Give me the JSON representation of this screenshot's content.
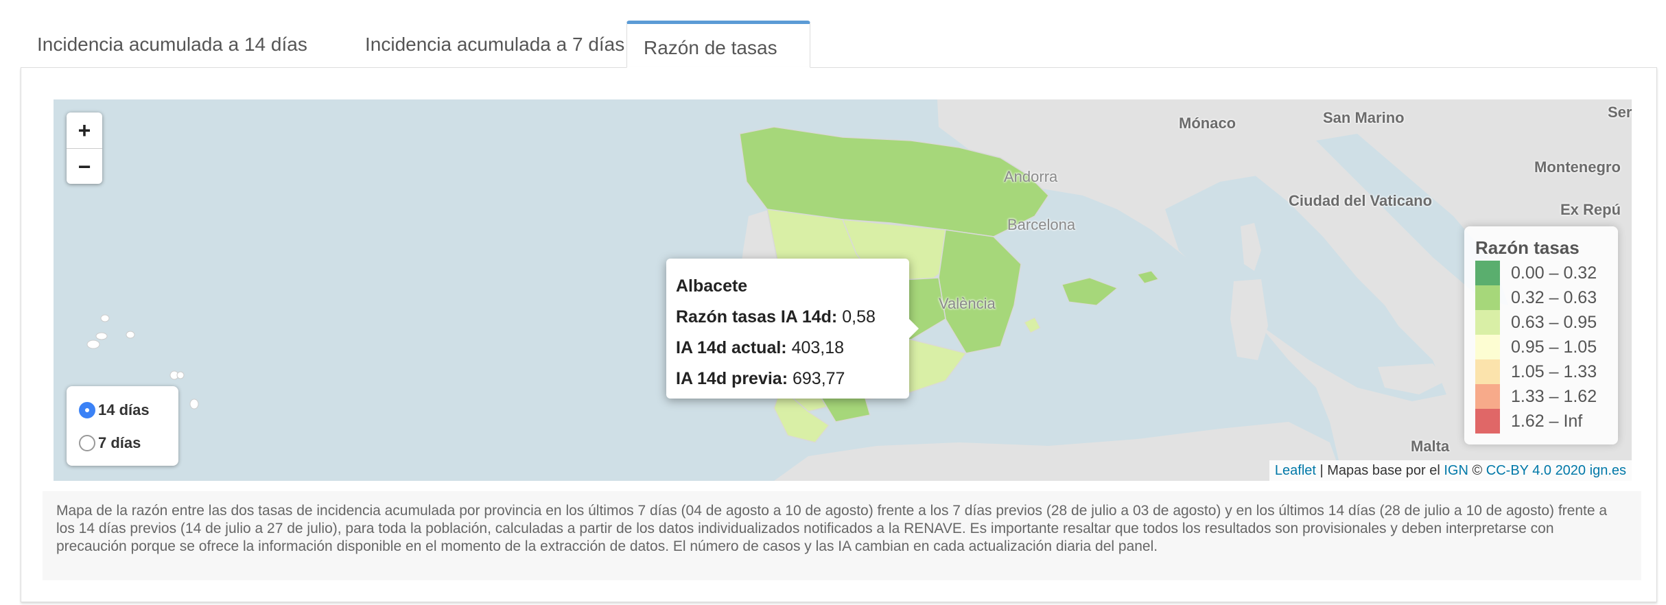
{
  "tabs": [
    {
      "label": "Incidencia acumulada a 14 días",
      "active": false
    },
    {
      "label": "Incidencia acumulada a 7 días",
      "active": false
    },
    {
      "label": "Razón de tasas",
      "active": true
    }
  ],
  "map": {
    "zoom_in": "+",
    "zoom_out": "−",
    "place_labels": [
      "Mónaco",
      "San Marino",
      "Ser",
      "Montenegro",
      "Ciudad del Vaticano",
      "Ex Repú",
      "Andorra",
      "Barcelona",
      "València",
      "Malta"
    ],
    "radio_options": [
      {
        "label": "14 días",
        "selected": true
      },
      {
        "label": "7 días",
        "selected": false
      }
    ],
    "tooltip": {
      "title": "Albacete",
      "ratio_label": "Razón tasas IA 14d:",
      "ratio_value": "0,58",
      "current_label": "IA 14d actual:",
      "current_value": "403,18",
      "previous_label": "IA 14d previa:",
      "previous_value": "693,77"
    },
    "legend": {
      "title": "Razón tasas",
      "items": [
        {
          "range": "0.00 – 0.32",
          "color": "#5aae6e"
        },
        {
          "range": "0.32 – 0.63",
          "color": "#a6d77a"
        },
        {
          "range": "0.63 – 0.95",
          "color": "#d9efa6"
        },
        {
          "range": "0.95 – 1.05",
          "color": "#fdfdd2"
        },
        {
          "range": "1.05 – 1.33",
          "color": "#fbe3ac"
        },
        {
          "range": "1.33 – 1.62",
          "color": "#f7aa8a"
        },
        {
          "range": "1.62 – Inf",
          "color": "#e06767"
        }
      ]
    },
    "attribution": {
      "leaflet": "Leaflet",
      "separator": " | Mapas base por el ",
      "ign": "IGN",
      "copyright": " © ",
      "license": "CC-BY 4.0 2020",
      "site": "ign.es"
    }
  },
  "caption": "Mapa de la razón entre las dos tasas de incidencia acumulada por provincia en los últimos 7 días (04 de agosto a 10 de agosto) frente a los 7 días previos (28 de julio a 03 de agosto) y en los últimos 14 días (28 de julio a 10 de agosto) frente a los 14 días previos (14 de julio a 27 de julio), para toda la población, calculadas a partir de los datos individualizados notificados a la RENAVE. Es importante resaltar que todos los resultados son provisionales y deben interpretarse con precaución porque se ofrece la información disponible en el momento de la extracción de datos. El número de casos y las IA cambian en cada actualización diaria del panel."
}
